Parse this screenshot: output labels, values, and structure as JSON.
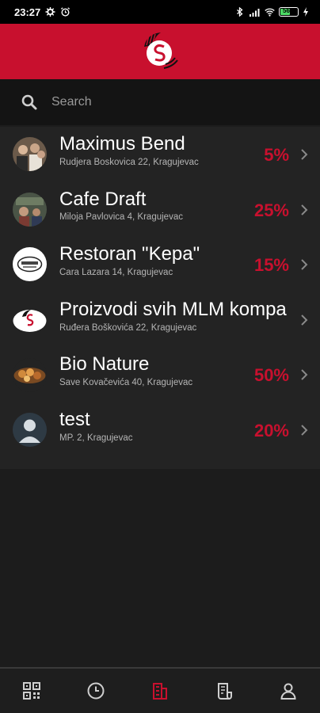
{
  "status": {
    "time": "23:27",
    "battery": "56"
  },
  "search": {
    "placeholder": "Search"
  },
  "colors": {
    "brand_red": "#c8102e",
    "background": "#1c1c1c",
    "list_background": "#232323"
  },
  "merchants": [
    {
      "name": "Maximus Bend",
      "address": "Rudjera Boskovica 22, Kragujevac",
      "discount": "5%",
      "avatar": "photo-group-icon"
    },
    {
      "name": "Cafe Draft",
      "address": "Miloja Pavlovica 4, Kragujevac",
      "discount": "25%",
      "avatar": "photo-cafe-icon"
    },
    {
      "name": "Restoran \"Kepa\"",
      "address": "Cara Lazara 14, Kragujevac",
      "discount": "15%",
      "avatar": "restaurant-logo-icon"
    },
    {
      "name": "Proizvodi svih MLM kompa",
      "address": "Ruđera Boškovića 22, Kragujevac",
      "discount": "",
      "avatar": "brand-logo-icon"
    },
    {
      "name": "Bio Nature",
      "address": "Save Kovačevića 40, Kragujevac",
      "discount": "50%",
      "avatar": "photo-food-icon"
    },
    {
      "name": "test",
      "address": "MP. 2, Kragujevac",
      "discount": "20%",
      "avatar": "default-user-icon"
    }
  ],
  "nav": [
    {
      "icon": "qr-code-icon",
      "active": false
    },
    {
      "icon": "clock-icon",
      "active": false
    },
    {
      "icon": "store-list-icon",
      "active": true
    },
    {
      "icon": "receipt-icon",
      "active": false
    },
    {
      "icon": "profile-icon",
      "active": false
    }
  ]
}
